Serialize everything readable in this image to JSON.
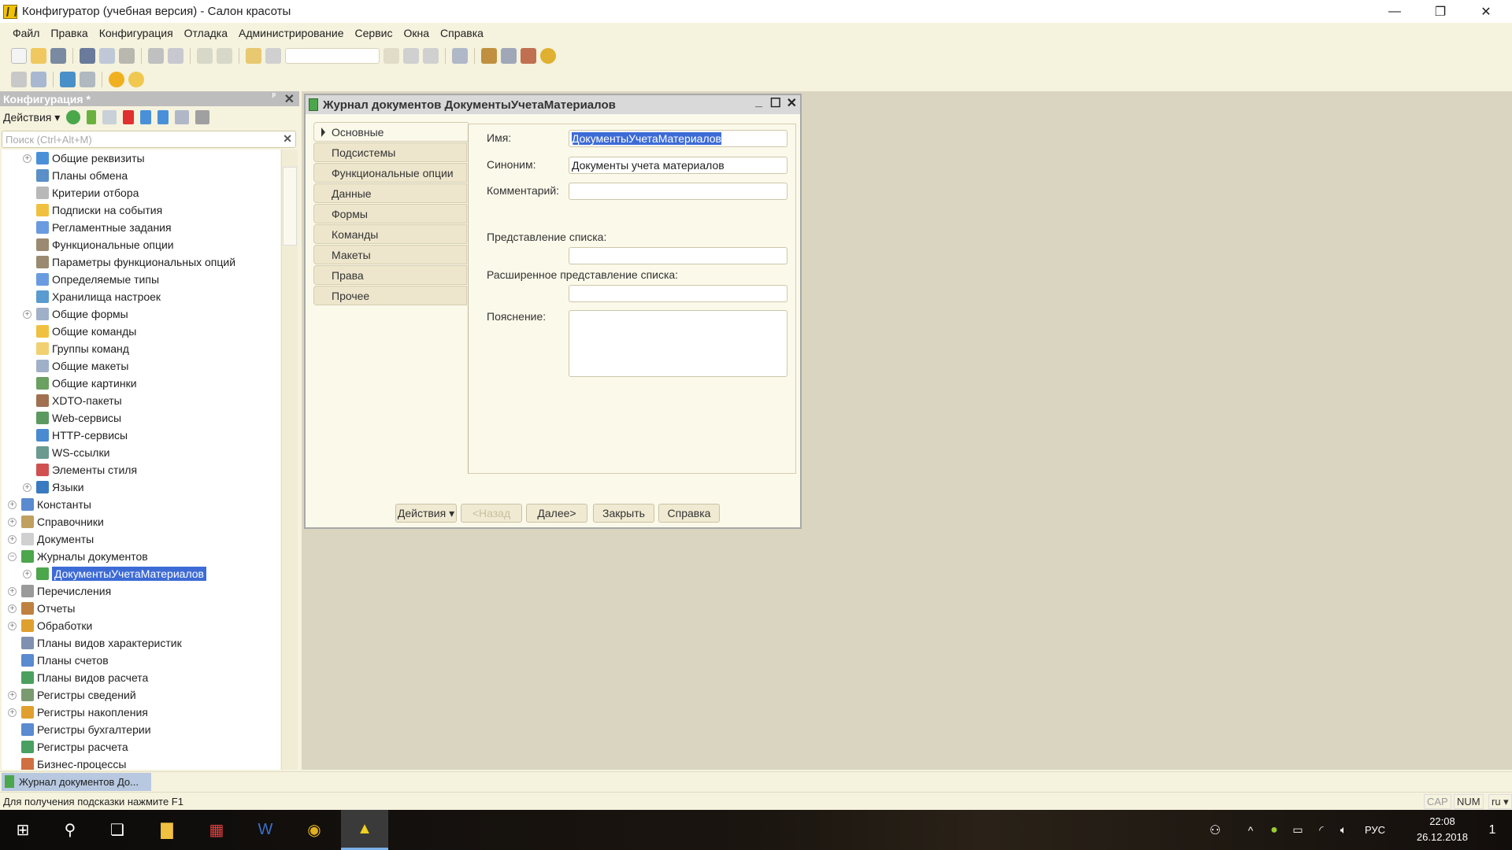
{
  "window": {
    "title": "Конфигуратор (учебная версия) - Салон красоты",
    "minimize": "—",
    "restore": "❐",
    "close": "✕"
  },
  "menu": [
    "Файл",
    "Правка",
    "Конфигурация",
    "Отладка",
    "Администрирование",
    "Сервис",
    "Окна",
    "Справка"
  ],
  "left_panel": {
    "title": "Конфигурация *",
    "pin": "ᵖ",
    "close": "✕",
    "actions_label": "Действия ▾",
    "search_placeholder": "Поиск (Ctrl+Alt+M)",
    "search_clear": "✕",
    "tree": [
      {
        "label": "Общие реквизиты",
        "level": 1,
        "exp": true,
        "color": "#4a90d9"
      },
      {
        "label": "Планы обмена",
        "level": 1,
        "exp": false,
        "color": "#5a8fc8"
      },
      {
        "label": "Критерии отбора",
        "level": 1,
        "exp": false,
        "color": "#b8b8b8"
      },
      {
        "label": "Подписки на события",
        "level": 1,
        "exp": false,
        "color": "#f0c040"
      },
      {
        "label": "Регламентные задания",
        "level": 1,
        "exp": false,
        "color": "#6a9be0"
      },
      {
        "label": "Функциональные опции",
        "level": 1,
        "exp": false,
        "color": "#9a8a70"
      },
      {
        "label": "Параметры функциональных опций",
        "level": 1,
        "exp": false,
        "color": "#9a8a70"
      },
      {
        "label": "Определяемые типы",
        "level": 1,
        "exp": false,
        "color": "#6a9be0"
      },
      {
        "label": "Хранилища настроек",
        "level": 1,
        "exp": false,
        "color": "#5a9bd0"
      },
      {
        "label": "Общие формы",
        "level": 1,
        "exp": true,
        "color": "#a0b0c8"
      },
      {
        "label": "Общие команды",
        "level": 1,
        "exp": false,
        "color": "#f0c040"
      },
      {
        "label": "Группы команд",
        "level": 1,
        "exp": false,
        "color": "#f0d070"
      },
      {
        "label": "Общие макеты",
        "level": 1,
        "exp": false,
        "color": "#a0b0c8"
      },
      {
        "label": "Общие картинки",
        "level": 1,
        "exp": false,
        "color": "#6aa060"
      },
      {
        "label": "XDTO-пакеты",
        "level": 1,
        "exp": false,
        "color": "#a07050"
      },
      {
        "label": "Web-сервисы",
        "level": 1,
        "exp": false,
        "color": "#5a9a60"
      },
      {
        "label": "HTTP-сервисы",
        "level": 1,
        "exp": false,
        "color": "#4a8ad0"
      },
      {
        "label": "WS-ссылки",
        "level": 1,
        "exp": false,
        "color": "#6a9a90"
      },
      {
        "label": "Элементы стиля",
        "level": 1,
        "exp": false,
        "color": "#d05050"
      },
      {
        "label": "Языки",
        "level": 1,
        "exp": true,
        "color": "#3a7ac0"
      },
      {
        "label": "Константы",
        "level": 0,
        "exp": true,
        "color": "#5a8ad0"
      },
      {
        "label": "Справочники",
        "level": 0,
        "exp": true,
        "color": "#c0a060"
      },
      {
        "label": "Документы",
        "level": 0,
        "exp": true,
        "color": "#d0d0d0"
      },
      {
        "label": "Журналы документов",
        "level": 0,
        "exp": true,
        "color": "#4ca64c",
        "open": true
      },
      {
        "label": "ДокументыУчетаМатериалов",
        "level": 1,
        "exp": true,
        "color": "#4ca64c",
        "selected": true
      },
      {
        "label": "Перечисления",
        "level": 0,
        "exp": true,
        "color": "#9a9a9a"
      },
      {
        "label": "Отчеты",
        "level": 0,
        "exp": true,
        "color": "#c08040"
      },
      {
        "label": "Обработки",
        "level": 0,
        "exp": true,
        "color": "#e0a030"
      },
      {
        "label": "Планы видов характеристик",
        "level": 0,
        "exp": false,
        "color": "#8090b0"
      },
      {
        "label": "Планы счетов",
        "level": 0,
        "exp": false,
        "color": "#5a8ad0"
      },
      {
        "label": "Планы видов расчета",
        "level": 0,
        "exp": false,
        "color": "#4aa060"
      },
      {
        "label": "Регистры сведений",
        "level": 0,
        "exp": true,
        "color": "#7a9a70"
      },
      {
        "label": "Регистры накопления",
        "level": 0,
        "exp": true,
        "color": "#e0a030"
      },
      {
        "label": "Регистры бухгалтерии",
        "level": 0,
        "exp": false,
        "color": "#5a8ad0"
      },
      {
        "label": "Регистры расчета",
        "level": 0,
        "exp": false,
        "color": "#4aa060"
      },
      {
        "label": "Бизнес-процессы",
        "level": 0,
        "exp": false,
        "color": "#d07040"
      }
    ]
  },
  "dialog": {
    "title": "Журнал документов ДокументыУчетаМатериалов",
    "minimize": "_",
    "maximize": "☐",
    "close": "✕",
    "tabs": [
      "Основные",
      "Подсистемы",
      "Функциональные опции",
      "Данные",
      "Формы",
      "Команды",
      "Макеты",
      "Права",
      "Прочее"
    ],
    "fields": {
      "name_label": "Имя:",
      "name_value": "ДокументыУчетаМатериалов",
      "synonym_label": "Синоним:",
      "synonym_value": "Документы учета материалов",
      "comment_label": "Комментарий:",
      "comment_value": "",
      "list_repr_label": "Представление списка:",
      "list_repr_value": "",
      "ext_list_repr_label": "Расширенное представление списка:",
      "ext_list_repr_value": "",
      "explanation_label": "Пояснение:",
      "explanation_value": ""
    },
    "buttons": {
      "actions": "Действия  ▾",
      "back": "<Назад",
      "next": "Далее>",
      "close": "Закрыть",
      "help": "Справка"
    }
  },
  "window_tab": "Журнал документов До...",
  "status": {
    "hint": "Для получения подсказки нажмите F1",
    "cap": "CAP",
    "num": "NUM",
    "lang": "ru ▾"
  },
  "taskbar": {
    "lang": "РУС",
    "time": "22:08",
    "date": "26.12.2018",
    "notifications": "1"
  }
}
